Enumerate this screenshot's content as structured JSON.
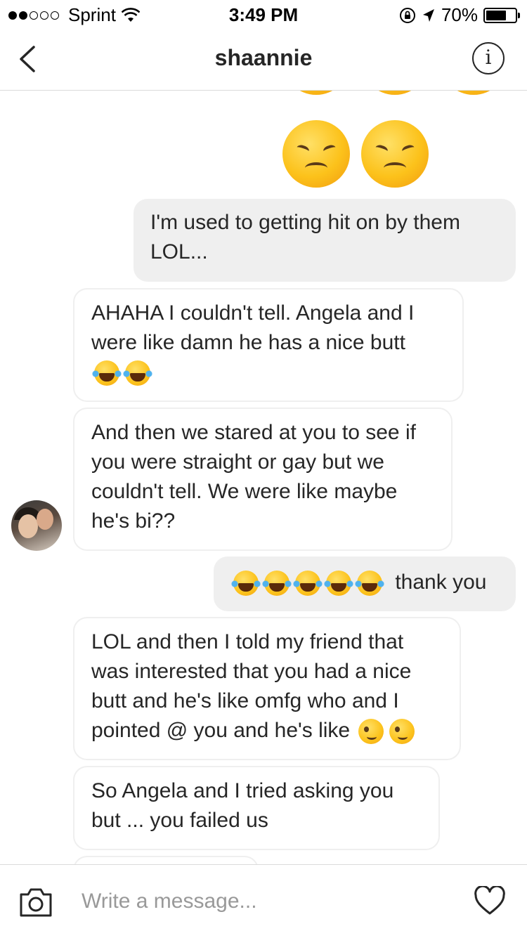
{
  "status_bar": {
    "carrier": "Sprint",
    "time": "3:49 PM",
    "battery": "70%",
    "battery_level": 0.7
  },
  "header": {
    "back_icon": "chevron-left-icon",
    "title": "shaannie",
    "info_label": "i"
  },
  "conversation": {
    "top_emojis": [
      "disappointed-face",
      "disappointed-face"
    ],
    "messages": [
      {
        "direction": "outgoing",
        "text": "I'm used to getting hit on by them LOL..."
      },
      {
        "direction": "incoming",
        "text": "AHAHA I couldn't tell. Angela and I were like damn he has a nice butt",
        "emojis": [
          "face-with-tears-of-joy",
          "face-with-tears-of-joy"
        ]
      },
      {
        "direction": "incoming",
        "text": "And then we stared at you to see if you were straight or gay but we couldn't tell. We were like maybe he's bi??"
      },
      {
        "direction": "outgoing",
        "text": "thank you",
        "emojis": [
          "face-with-tears-of-joy",
          "face-with-tears-of-joy",
          "face-with-tears-of-joy",
          "face-with-tears-of-joy",
          "face-with-tears-of-joy"
        ]
      },
      {
        "direction": "incoming",
        "text": "LOL and then I told my friend that was interested that you had a nice butt and he's like omfg who and I pointed @ you and he's like",
        "emojis": [
          "winking-face",
          "winking-face"
        ]
      },
      {
        "direction": "incoming",
        "text": "So Angela and I tried asking you but ... you failed us"
      }
    ]
  },
  "composer": {
    "placeholder": "Write a message...",
    "camera_icon": "camera-icon",
    "heart_icon": "heart-icon"
  },
  "colors": {
    "outgoing_bubble": "#efefef",
    "incoming_border": "#efefef",
    "text": "#262626",
    "placeholder": "#999999",
    "divider": "#dbdbdb"
  }
}
